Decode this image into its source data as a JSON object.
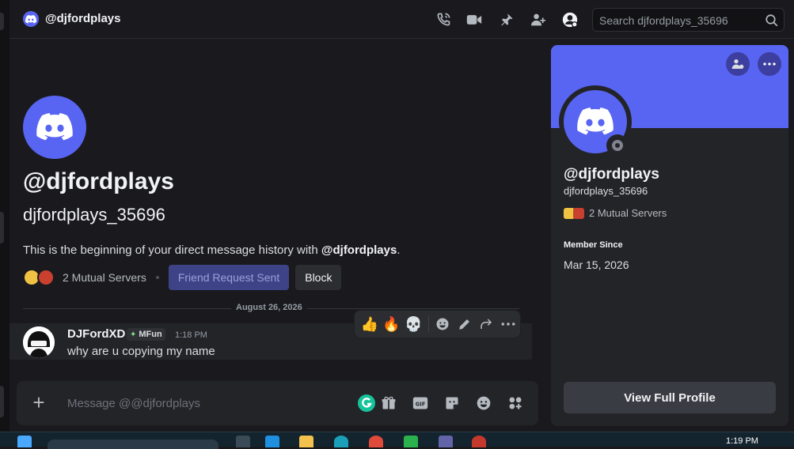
{
  "header": {
    "title": "@djfordplays",
    "search_placeholder": "Search djfordplays_35696",
    "icons": [
      "voice-call-icon",
      "video-call-icon",
      "pinned-icon",
      "add-friend-dm-icon",
      "show-profile-icon",
      "search-icon"
    ]
  },
  "intro": {
    "display_name": "@djfordplays",
    "username": "djfordplays_35696",
    "beginning_prefix": "This is the beginning of your direct message history with ",
    "beginning_name": "@djfordplays",
    "beginning_suffix": ".",
    "mutual_servers": "2 Mutual Servers",
    "friend_request_button": "Friend Request Sent",
    "block_button": "Block"
  },
  "divider_date": "August 26, 2026",
  "message": {
    "author": "DJFordXD",
    "tag": "MFun",
    "time": "1:18 PM",
    "text": "why are u copying my name"
  },
  "hover_actions": [
    "thumbs-up",
    "fire",
    "skull",
    "add-reaction",
    "edit",
    "forward",
    "more"
  ],
  "reactions": {
    "thumbs": "👍",
    "fire": "🔥",
    "skull": "💀"
  },
  "composer": {
    "placeholder": "Message @@djfordplays"
  },
  "profile": {
    "display_name": "@djfordplays",
    "username": "djfordplays_35696",
    "mutual_servers": "2 Mutual Servers",
    "member_since_label": "Member Since",
    "member_since": "Mar 15, 2026",
    "view_full_profile": "View Full Profile"
  },
  "taskbar": {
    "time": "1:19 PM"
  },
  "colors": {
    "brand": "#5865f2",
    "background": "#1a1a1e",
    "panel": "#232428"
  }
}
